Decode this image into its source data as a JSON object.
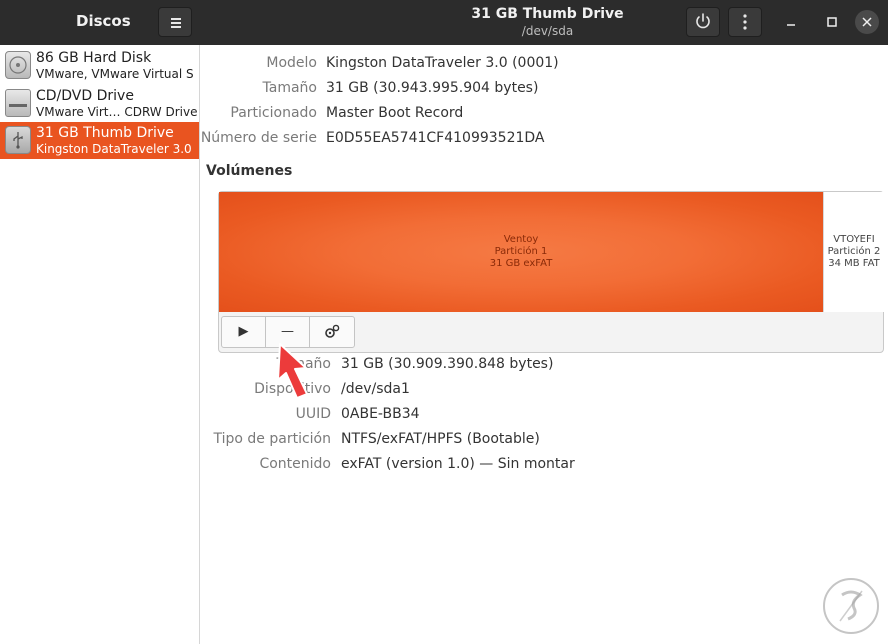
{
  "app": {
    "title": "Discos"
  },
  "drive_header": {
    "title": "31 GB Thumb Drive",
    "subtitle": "/dev/sda"
  },
  "drives": [
    {
      "name": "86 GB Hard Disk",
      "desc": "VMware, VMware Virtual S"
    },
    {
      "name": "CD/DVD Drive",
      "desc": "VMware Virt… CDRW Drive"
    },
    {
      "name": "31 GB Thumb Drive",
      "desc": "Kingston DataTraveler 3.0"
    }
  ],
  "drive_info": [
    {
      "label": "Modelo",
      "value": "Kingston DataTraveler 3.0 (0001)"
    },
    {
      "label": "Tamaño",
      "value": "31 GB (30.943.995.904 bytes)"
    },
    {
      "label": "Particionado",
      "value": "Master Boot Record"
    },
    {
      "label": "Número de serie",
      "value": "E0D55EA5741CF410993521DA"
    }
  ],
  "volumes": {
    "title": "Volúmenes",
    "partition1": {
      "name": "Ventoy",
      "label": "Partición 1",
      "size": "31 GB exFAT"
    },
    "partition2": {
      "name": "VTOYEFI",
      "label": "Partición 2",
      "size": "34 MB FAT"
    }
  },
  "volume_toolbar": {
    "play": "▶",
    "minus": "—"
  },
  "volume_info": [
    {
      "label": "Tamaño",
      "value": "31 GB (30.909.390.848 bytes)"
    },
    {
      "label": "Dispositivo",
      "value": "/dev/sda1"
    },
    {
      "label": "UUID",
      "value": "0ABE-BB34"
    },
    {
      "label": "Tipo de partición",
      "value": "NTFS/exFAT/HPFS (Bootable)"
    },
    {
      "label": "Contenido",
      "value": "exFAT (version 1.0) — Sin montar"
    }
  ],
  "colors": {
    "accent": "#e95420",
    "titlebar": "#2c2c2c",
    "annotation": "#e53935"
  },
  "icons": {
    "menu": "hamburger-icon",
    "power": "power-icon",
    "more": "kebab-icon",
    "minimize": "minimize-icon",
    "maximize": "maximize-icon",
    "close": "close-icon",
    "settings": "gears-icon"
  }
}
